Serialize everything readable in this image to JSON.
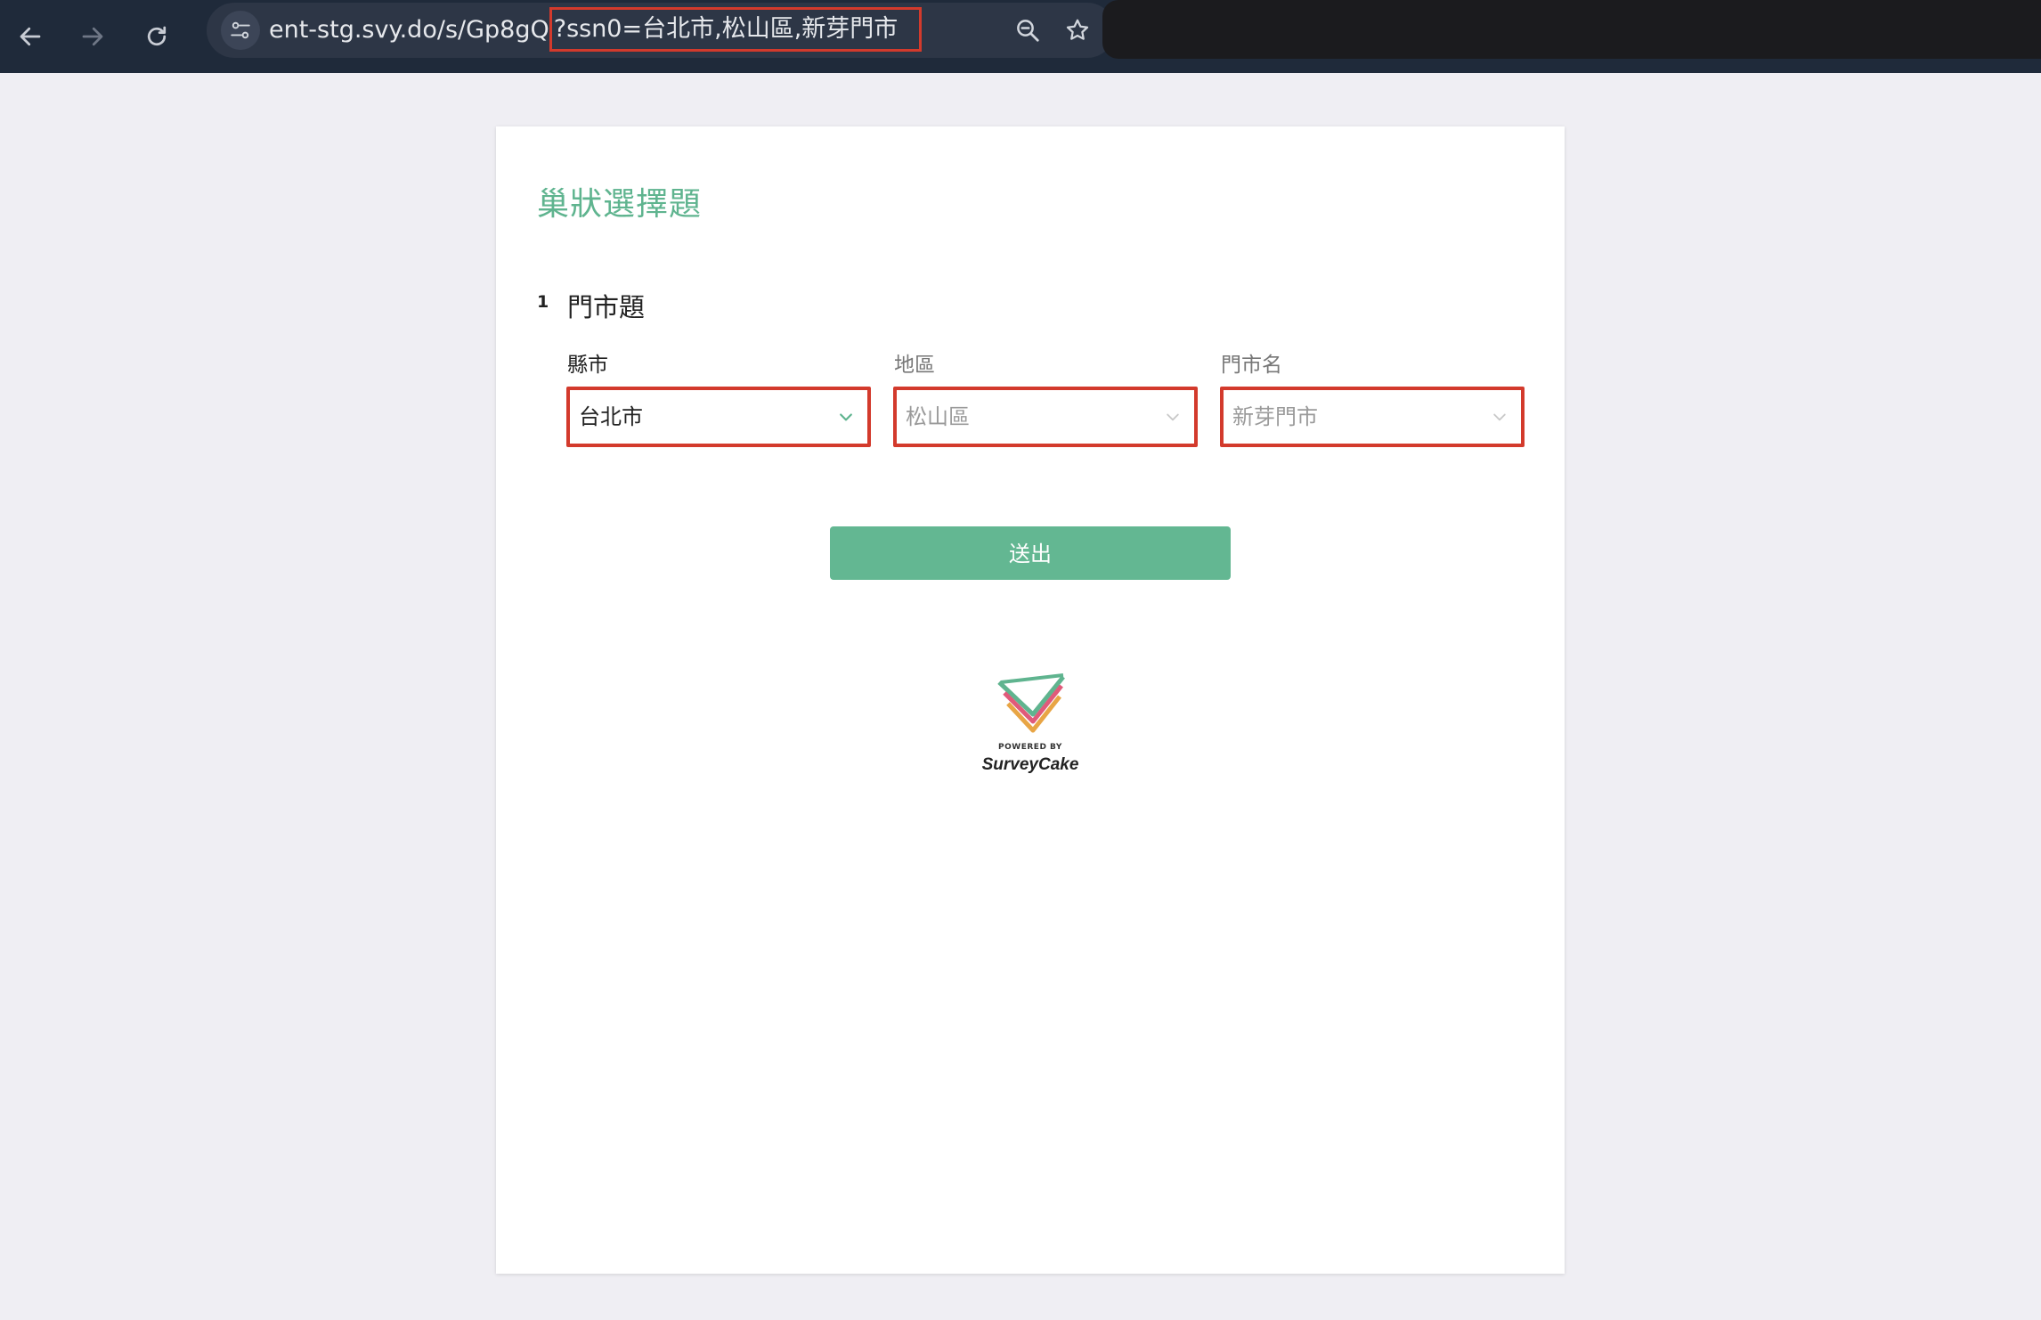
{
  "browser": {
    "url_base": "ent-stg.svy.do/s/Gp8gQ",
    "url_query": "?ssn0=台北市,松山區,新芽門市"
  },
  "survey": {
    "title": "巢狀選擇題",
    "question_number": "1",
    "question_title": "門市題",
    "fields": [
      {
        "label": "縣市",
        "value": "台北市",
        "enabled": true
      },
      {
        "label": "地區",
        "value": "松山區",
        "enabled": false
      },
      {
        "label": "門市名",
        "value": "新芽門市",
        "enabled": false
      }
    ],
    "submit_label": "送出",
    "footer": {
      "powered_by": "POWERED BY",
      "brand": "SurveyCake"
    }
  },
  "colors": {
    "accent_green": "#63b792",
    "title_green": "#5fb48f",
    "highlight_red": "#d33a2c",
    "toolbar_bg": "#1f2a3a"
  }
}
